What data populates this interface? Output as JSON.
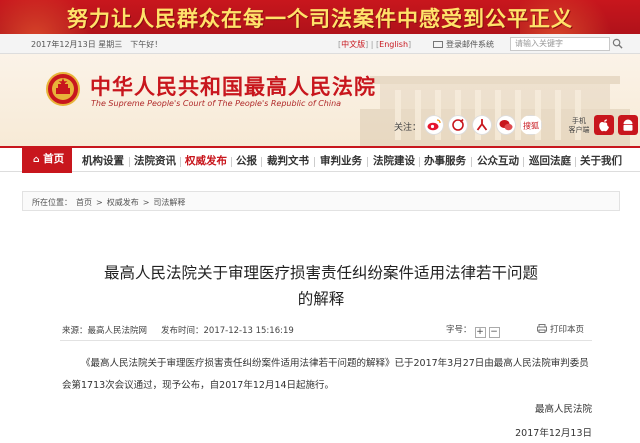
{
  "slogan": "努力让人民群众在每一个司法案件中感受到公平正义",
  "topbar": {
    "date": "2017年12月13日 星期三　下午好！",
    "lang_cn": "中文版",
    "lang_en": "English",
    "login": "登录邮件系统",
    "search_placeholder": "请输入关键字"
  },
  "header": {
    "title": "中华人民共和国最高人民法院",
    "subtitle": "The Supreme People's Court of The People's Republic of China",
    "follow_label": "关注：",
    "mobile_label_1": "手机",
    "mobile_label_2": "客户端"
  },
  "nav": {
    "items": [
      "首页",
      "机构设置",
      "法院资讯",
      "权威发布",
      "公报",
      "裁判文书",
      "审判业务",
      "法院建设",
      "办事服务",
      "公众互动",
      "巡回法庭",
      "关于我们"
    ]
  },
  "breadcrumb": {
    "label": "所在位置：",
    "items": [
      "首页",
      "权威发布",
      "司法解释"
    ],
    "sep": ">"
  },
  "article": {
    "title_line1": "最高人民法院关于审理医疗损害责任纠纷案件适用法律若干问题",
    "title_line2": "的解释",
    "source": "来源：最高人民法院网",
    "time": "发布时间：2017-12-13 15:16:19",
    "font_label": "字号：",
    "font_plus": "+",
    "font_minus": "−",
    "print": "打印本页",
    "body": "《最高人民法院关于审理医疗损害责任纠纷案件适用法律若干问题的解释》已于2017年3月27日由最高人民法院审判委员会第1713次会议通过，现予公布，自2017年12月14日起施行。",
    "sign_org": "最高人民法院",
    "sign_date": "2017年12月13日"
  },
  "colors": {
    "brand_red": "#c8161d",
    "slogan_yellow": "#ffe36a",
    "header_bg": "#fbf3e8"
  },
  "icons": [
    "weibo-icon",
    "weibo-2-icon",
    "people-icon",
    "wechat-icon",
    "sohu-icon",
    "apple-icon",
    "android-icon",
    "search-icon",
    "print-icon",
    "emblem-icon",
    "home-icon"
  ]
}
